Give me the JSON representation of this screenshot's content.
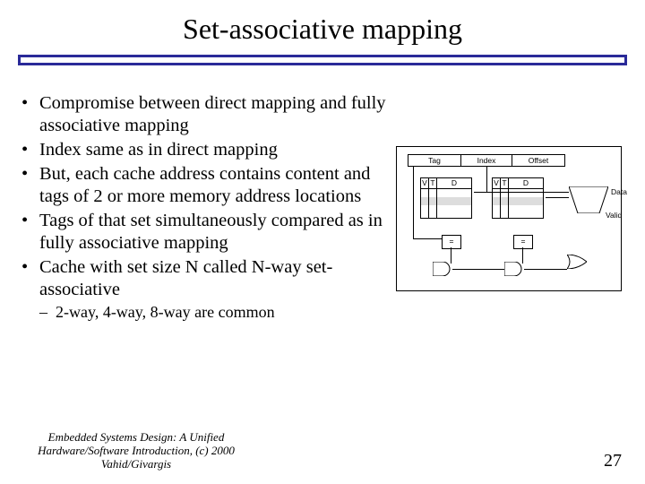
{
  "title": "Set-associative mapping",
  "bullets": [
    "Compromise between direct mapping and fully associative mapping",
    "Index same as in direct mapping",
    "But, each cache address contains content and tags of 2 or more memory address locations",
    "Tags of that set simultaneously compared as in fully associative mapping",
    "Cache with set size N called N-way set-associative"
  ],
  "sub_bullet": "2-way, 4-way, 8-way are common",
  "diagram": {
    "addr": {
      "tag": "Tag",
      "index": "Index",
      "offset": "Offset"
    },
    "cols": {
      "v": "V",
      "t": "T",
      "d": "D"
    },
    "eq": "=",
    "labels": {
      "data": "Data",
      "valid": "Valid"
    }
  },
  "footer": {
    "source_line1": "Embedded Systems Design: A Unified",
    "source_line2": "Hardware/Software Introduction, (c) 2000 Vahid/Givargis",
    "page": "27"
  }
}
